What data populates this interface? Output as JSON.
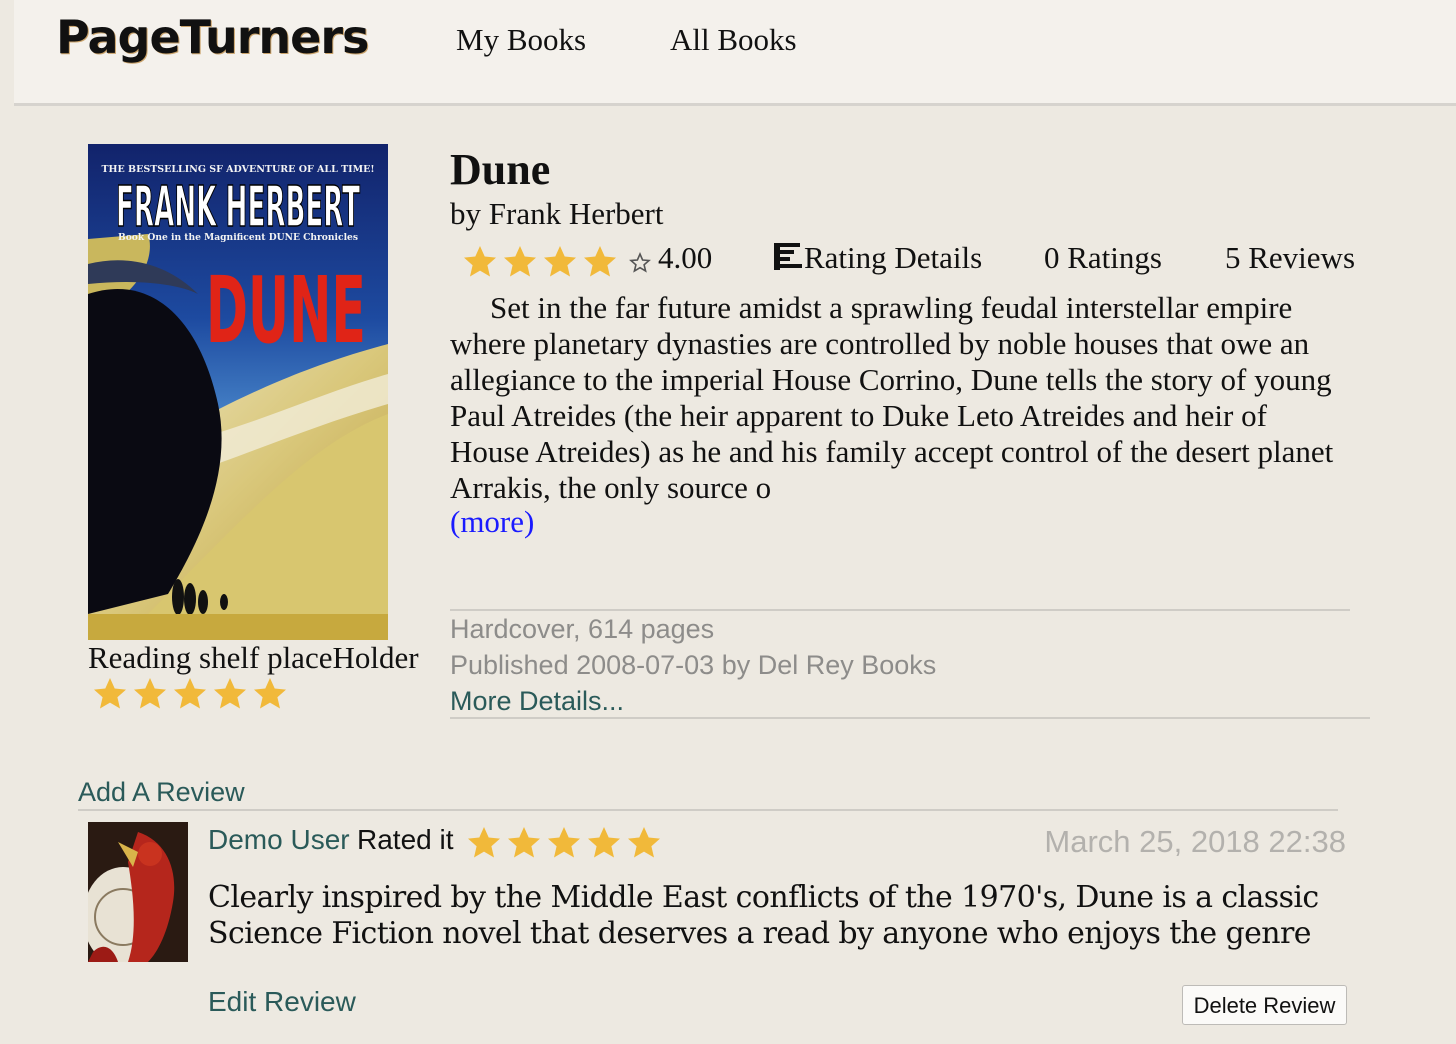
{
  "header": {
    "logo": "PageTurners",
    "nav": {
      "my_books": "My Books",
      "all_books": "All Books"
    }
  },
  "book": {
    "cover_text": {
      "tagline": "THE BESTSELLING SF ADVENTURE OF ALL TIME!",
      "author": "FRANK HERBERT",
      "subtitle": "Book One in the Magnificent DUNE Chronicles",
      "title": "DUNE"
    },
    "title": "Dune",
    "author_line": "by Frank Herbert",
    "average_rating": "4.00",
    "rating_value": 4,
    "rating_max": 5,
    "rating_details_label": "Rating Details",
    "ratings_count": "0 Ratings",
    "reviews_count": "5 Reviews",
    "description": "Set in the far future amidst a sprawling feudal interstellar empire where planetary dynasties are controlled by noble houses that owe an allegiance to the imperial House Corrino, Dune tells the story of young Paul Atreides (the heir apparent to Duke Leto Atreides and heir of House Atreides) as he and his family accept control of the desert planet Arrakis, the only source o",
    "more_label": "(more)",
    "format": "Hardcover, 614 pages",
    "published": "Published 2008-07-03 by Del Rey Books",
    "more_details": "More Details..."
  },
  "shelf": {
    "label": "Reading shelf placeHolder",
    "user_rating": 5
  },
  "reviews": {
    "add_label": "Add A Review",
    "items": [
      {
        "user": "Demo User",
        "rated_it": "Rated it",
        "rating": 5,
        "date": "March 25, 2018 22:38",
        "text": "Clearly inspired by the Middle East conflicts of the 1970's, Dune is a classic Science Fiction novel that deserves a read by anyone who enjoys the genre",
        "edit_label": "Edit Review",
        "delete_label": "Delete Review"
      }
    ]
  },
  "colors": {
    "background": "#ede9e1",
    "header_bg": "#f4f1ec",
    "star": "#f1b93a",
    "link_teal": "#2a5a59",
    "link_blue": "#1a1aff",
    "muted": "#8d8c8a"
  },
  "icons": {
    "star_filled": "star-icon",
    "star_empty": "star-outline-icon",
    "rating_details": "bar-chart-icon"
  }
}
